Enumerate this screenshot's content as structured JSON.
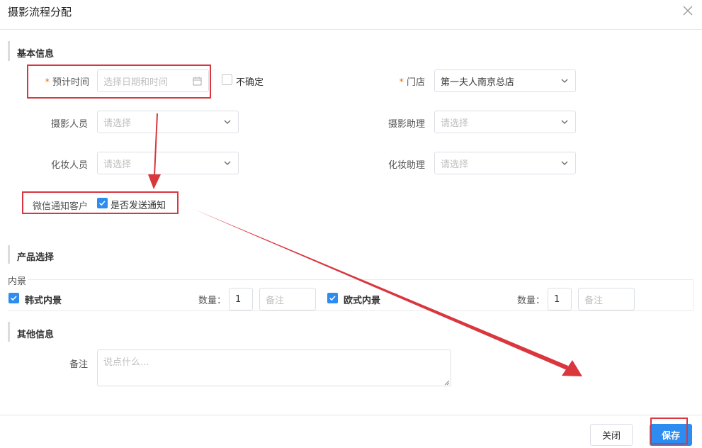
{
  "dialog": {
    "title": "摄影流程分配"
  },
  "basic": {
    "section_title": "基本信息",
    "time_label": "预计时间",
    "time_placeholder": "选择日期和时间",
    "uncertain_label": "不确定",
    "store_label": "门店",
    "store_value": "第一夫人南京总店",
    "photographer_label": "摄影人员",
    "photographer_placeholder": "请选择",
    "photo_assistant_label": "摄影助理",
    "photo_assistant_placeholder": "请选择",
    "makeup_label": "化妆人员",
    "makeup_placeholder": "请选择",
    "makeup_assistant_label": "化妆助理",
    "makeup_assistant_placeholder": "请选择",
    "wechat_label": "微信通知客户",
    "wechat_checkbox_label": "是否发送通知",
    "required_mark": "*"
  },
  "products": {
    "section_title": "产品选择",
    "group_label": "内景",
    "items": [
      {
        "name": "韩式内景",
        "qty_label": "数量：",
        "qty": "1",
        "remark_placeholder": "备注"
      },
      {
        "name": "欧式内景",
        "qty_label": "数量：",
        "qty": "1",
        "remark_placeholder": "备注"
      }
    ]
  },
  "other": {
    "section_title": "其他信息",
    "remark_label": "备注",
    "remark_placeholder": "说点什么..."
  },
  "footer": {
    "close_label": "关闭",
    "save_label": "保存"
  },
  "colors": {
    "primary": "#2d8cf0",
    "annotation_red": "#d9363e",
    "required": "#e8720c"
  }
}
